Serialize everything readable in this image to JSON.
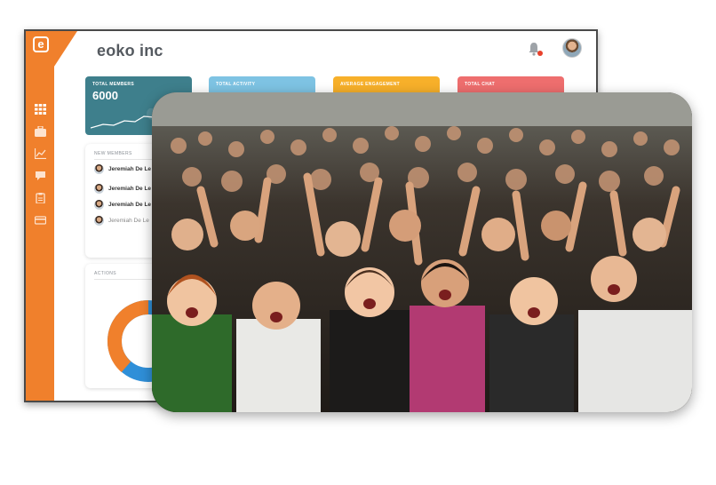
{
  "app": {
    "title": "eoko inc",
    "logo_letter": "e"
  },
  "colors": {
    "brand": "#f0802c",
    "members_card": "#3e7f8c",
    "activity_card": "#7ec3e3",
    "engagement_card": "#f7b02a",
    "chat_card": "#ee6e6e",
    "notification_dot": "#e8412c"
  },
  "sidebar": {
    "items": [
      {
        "icon": "grid-icon"
      },
      {
        "icon": "briefcase-icon"
      },
      {
        "icon": "chart-icon"
      },
      {
        "icon": "chat-icon"
      },
      {
        "icon": "clipboard-icon"
      },
      {
        "icon": "card-icon"
      }
    ]
  },
  "header": {
    "notifications_icon": "bell-icon",
    "avatar": "user-avatar"
  },
  "stats": {
    "members": {
      "label": "TOTAL MEMBERS",
      "value": "6000"
    },
    "activity": {
      "label": "TOTAL ACTIVITY"
    },
    "engagement": {
      "label": "AVERAGE ENGAGEMENT"
    },
    "chat": {
      "label": "TOTAL CHAT"
    }
  },
  "new_members": {
    "title": "NEW MEMBERS",
    "items": [
      {
        "name": "Jeremiah De Le"
      },
      {
        "name": "Jeremiah De Le"
      },
      {
        "name": "Jeremiah De Le"
      },
      {
        "name": "Jeremiah De Le"
      }
    ]
  },
  "actions": {
    "title": "ACTIONS"
  },
  "photo": {
    "subject": "cheering crowd photo"
  }
}
